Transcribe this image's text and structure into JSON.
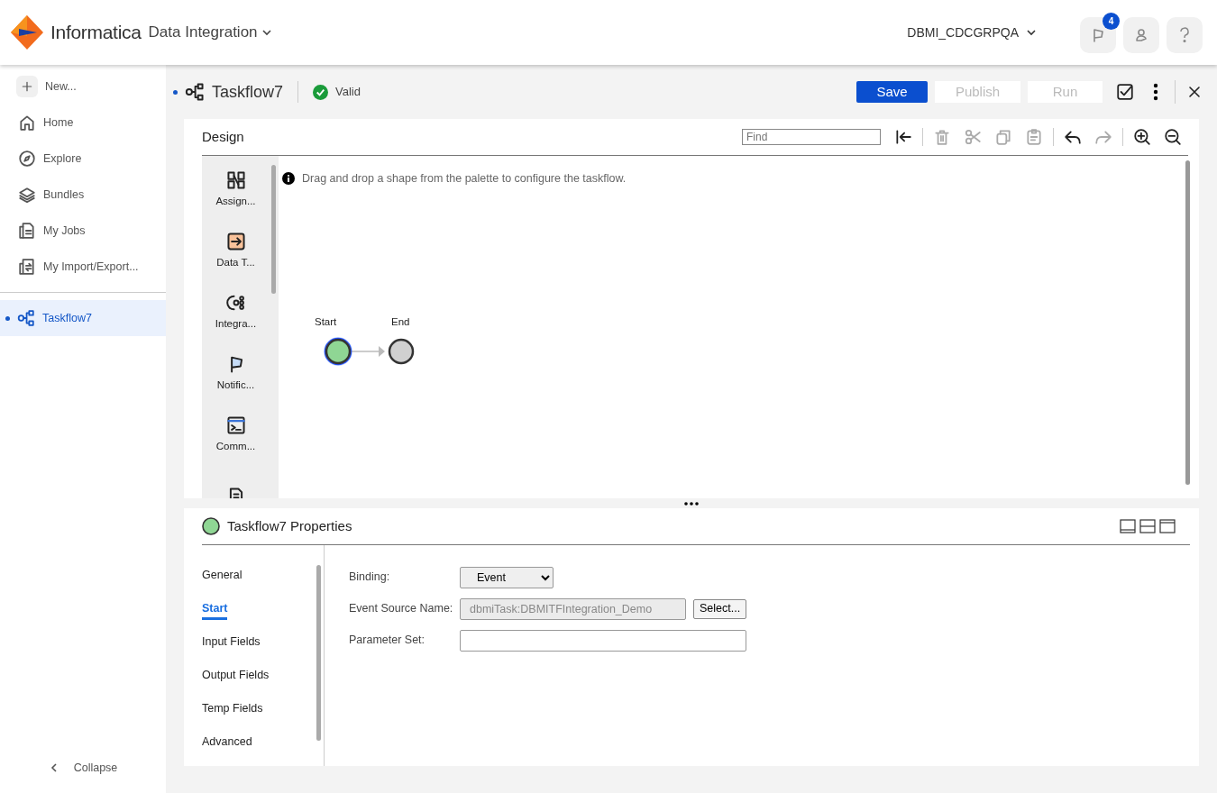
{
  "header": {
    "brand": "Informatica",
    "product": "Data Integration",
    "org": "DBMI_CDCGRPQA",
    "notification_count": "4"
  },
  "sidebar": {
    "items": [
      {
        "label": "New..."
      },
      {
        "label": "Home"
      },
      {
        "label": "Explore"
      },
      {
        "label": "Bundles"
      },
      {
        "label": "My Jobs"
      },
      {
        "label": "My Import/Export..."
      }
    ],
    "open_items": [
      {
        "label": "Taskflow7",
        "selected": true,
        "modified": true
      }
    ],
    "collapse": "Collapse"
  },
  "editor": {
    "title": "Taskflow7",
    "modified": true,
    "status": "Valid",
    "buttons": [
      {
        "label": "Save",
        "disabled": false
      },
      {
        "label": "Publish",
        "disabled": true
      },
      {
        "label": "Run",
        "disabled": true
      }
    ]
  },
  "design": {
    "title": "Design",
    "find_placeholder": "Find",
    "tools": [
      {
        "disabled": false
      },
      {
        "disabled": true
      },
      {
        "disabled": true
      },
      {
        "disabled": true
      },
      {
        "disabled": true
      },
      {
        "disabled": false
      },
      {
        "disabled": true
      },
      {
        "disabled": false
      },
      {
        "disabled": false
      }
    ],
    "palette": [
      {
        "label": "Assign..."
      },
      {
        "label": "Data T..."
      },
      {
        "label": "Integra..."
      },
      {
        "label": "Notific..."
      },
      {
        "label": "Comm..."
      }
    ],
    "hint": "Drag and drop a shape from the palette to configure the taskflow.",
    "nodes": [
      {
        "label": "Start",
        "kind": "start",
        "selected": true
      },
      {
        "label": "End",
        "kind": "end",
        "selected": false
      }
    ]
  },
  "properties": {
    "title": "Taskflow7 Properties",
    "tabs": [
      {
        "label": "General",
        "selected": false
      },
      {
        "label": "Start",
        "selected": true
      },
      {
        "label": "Input Fields",
        "selected": false
      },
      {
        "label": "Output Fields",
        "selected": false
      },
      {
        "label": "Temp Fields",
        "selected": false
      },
      {
        "label": "Advanced",
        "selected": false
      }
    ],
    "fields": [
      {
        "label": "Binding:",
        "kind": "select",
        "value": "Event"
      },
      {
        "label": "Event Source Name:",
        "kind": "text",
        "value": "dbmiTask:DBMITFIntegration_Demo",
        "disabled": true,
        "button": "Select..."
      },
      {
        "label": "Parameter Set:",
        "kind": "text",
        "disabled": false
      }
    ]
  }
}
